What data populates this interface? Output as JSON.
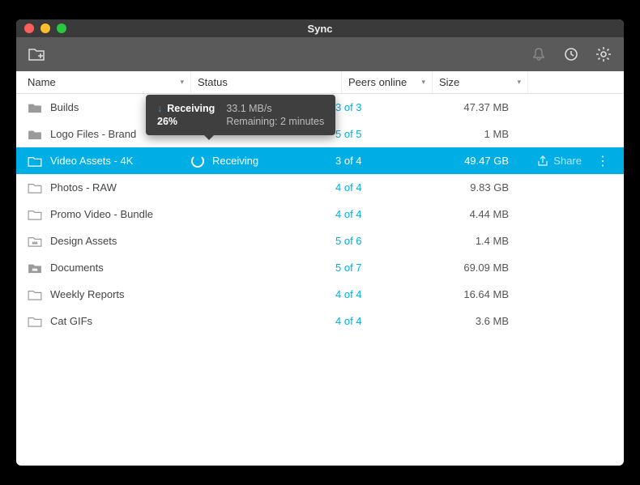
{
  "window": {
    "title": "Sync"
  },
  "toolbar": {
    "add_folder": "add-folder",
    "bell": "bell",
    "history": "history",
    "gear": "gear"
  },
  "columns": {
    "name": "Name",
    "status": "Status",
    "peers": "Peers online",
    "size": "Size"
  },
  "tooltip": {
    "label": "Receiving",
    "percent": "26%",
    "speed": "33.1 MB/s",
    "remaining": "Remaining: 2 minutes"
  },
  "share": {
    "label": "Share"
  },
  "rows": [
    {
      "name": "Builds",
      "status": "",
      "peers": "3 of 3",
      "size": "47.37 MB",
      "type": "solid"
    },
    {
      "name": "Logo Files - Brand",
      "status": "",
      "peers": "5 of 5",
      "size": "1 MB",
      "type": "solid"
    },
    {
      "name": "Video Assets - 4K",
      "status": "Receiving",
      "peers": "3 of 4",
      "size": "49.47 GB",
      "type": "outline",
      "selected": true
    },
    {
      "name": "Photos - RAW",
      "status": "",
      "peers": "4 of 4",
      "size": "9.83 GB",
      "type": "outline"
    },
    {
      "name": "Promo Video - Bundle",
      "status": "",
      "peers": "4 of 4",
      "size": "4.44 MB",
      "type": "outline"
    },
    {
      "name": "Design Assets",
      "status": "",
      "peers": "5 of 6",
      "size": "1.4 MB",
      "type": "crown"
    },
    {
      "name": "Documents",
      "status": "",
      "peers": "5 of 7",
      "size": "69.09 MB",
      "type": "crown-solid"
    },
    {
      "name": "Weekly Reports",
      "status": "",
      "peers": "4 of 4",
      "size": "16.64 MB",
      "type": "outline"
    },
    {
      "name": "Cat GIFs",
      "status": "",
      "peers": "4 of 4",
      "size": "3.6 MB",
      "type": "outline"
    }
  ]
}
